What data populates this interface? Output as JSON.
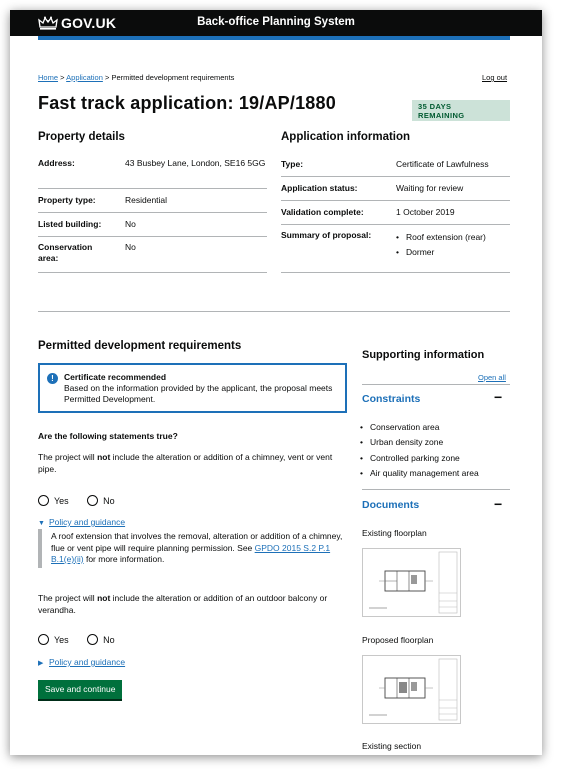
{
  "header": {
    "logo_text": "GOV.UK",
    "service_name": "Back-office Planning System"
  },
  "breadcrumb": {
    "home": "Home",
    "sep1": ">",
    "application": "Application",
    "sep2": ">",
    "current": "Permitted development requirements"
  },
  "logout_label": "Log out",
  "page_title": "Fast track application: 19/AP/1880",
  "days_tag": {
    "line1": "35 DAYS",
    "line2": "REMAINING"
  },
  "property": {
    "heading": "Property details",
    "rows": [
      {
        "key": "Address:",
        "value": "43 Busbey Lane, London, SE16 5GG"
      },
      {
        "key": "Property type:",
        "value": "Residential"
      },
      {
        "key": "Listed building:",
        "value": "No"
      },
      {
        "key": "Conservation area:",
        "value": "No"
      }
    ]
  },
  "application_info": {
    "heading": "Application information",
    "rows": [
      {
        "key": "Type:",
        "value": "Certificate of Lawfulness"
      },
      {
        "key": "Application status:",
        "value": "Waiting for review"
      },
      {
        "key": "Validation complete:",
        "value": "1 October 2019"
      }
    ],
    "summary_key": "Summary of proposal:",
    "summary_items": [
      "Roof extension (rear)",
      "Dormer"
    ]
  },
  "pdr": {
    "heading": "Permitted development requirements",
    "panel_title": "Certificate recommended",
    "panel_body": "Based on the information provided by the applicant, the proposal meets Permitted Development.",
    "question": "Are the following statements true?",
    "statement1": {
      "before": "The project will ",
      "bold": "not",
      "after": " include the alteration or addition of a chimney, vent or vent pipe."
    },
    "statement2": {
      "before": "The project will ",
      "bold": "not",
      "after": " include the alteration or addition of an outdoor balcony or verandha."
    },
    "yes_label": "Yes",
    "no_label": "No",
    "policy_label": "Policy and guidance",
    "details_text_before": "A roof extension that involves the removal, alteration or addition of a chimney, flue or vent pipe will require planning permission. See ",
    "details_link": "GPDO 2015 S.2 P.1 B.1(e)(ii)",
    "details_text_after": " for more information.",
    "save_button": "Save and continue"
  },
  "supporting": {
    "heading": "Supporting information",
    "open_all": "Open all",
    "constraints_heading": "Constraints",
    "constraints": [
      "Conservation area",
      "Urban density zone",
      "Controlled parking zone",
      "Air quality management area"
    ],
    "documents_heading": "Documents",
    "toggle_symbol": "−",
    "documents": [
      "Existing floorplan",
      "Proposed floorplan",
      "Existing section"
    ]
  }
}
